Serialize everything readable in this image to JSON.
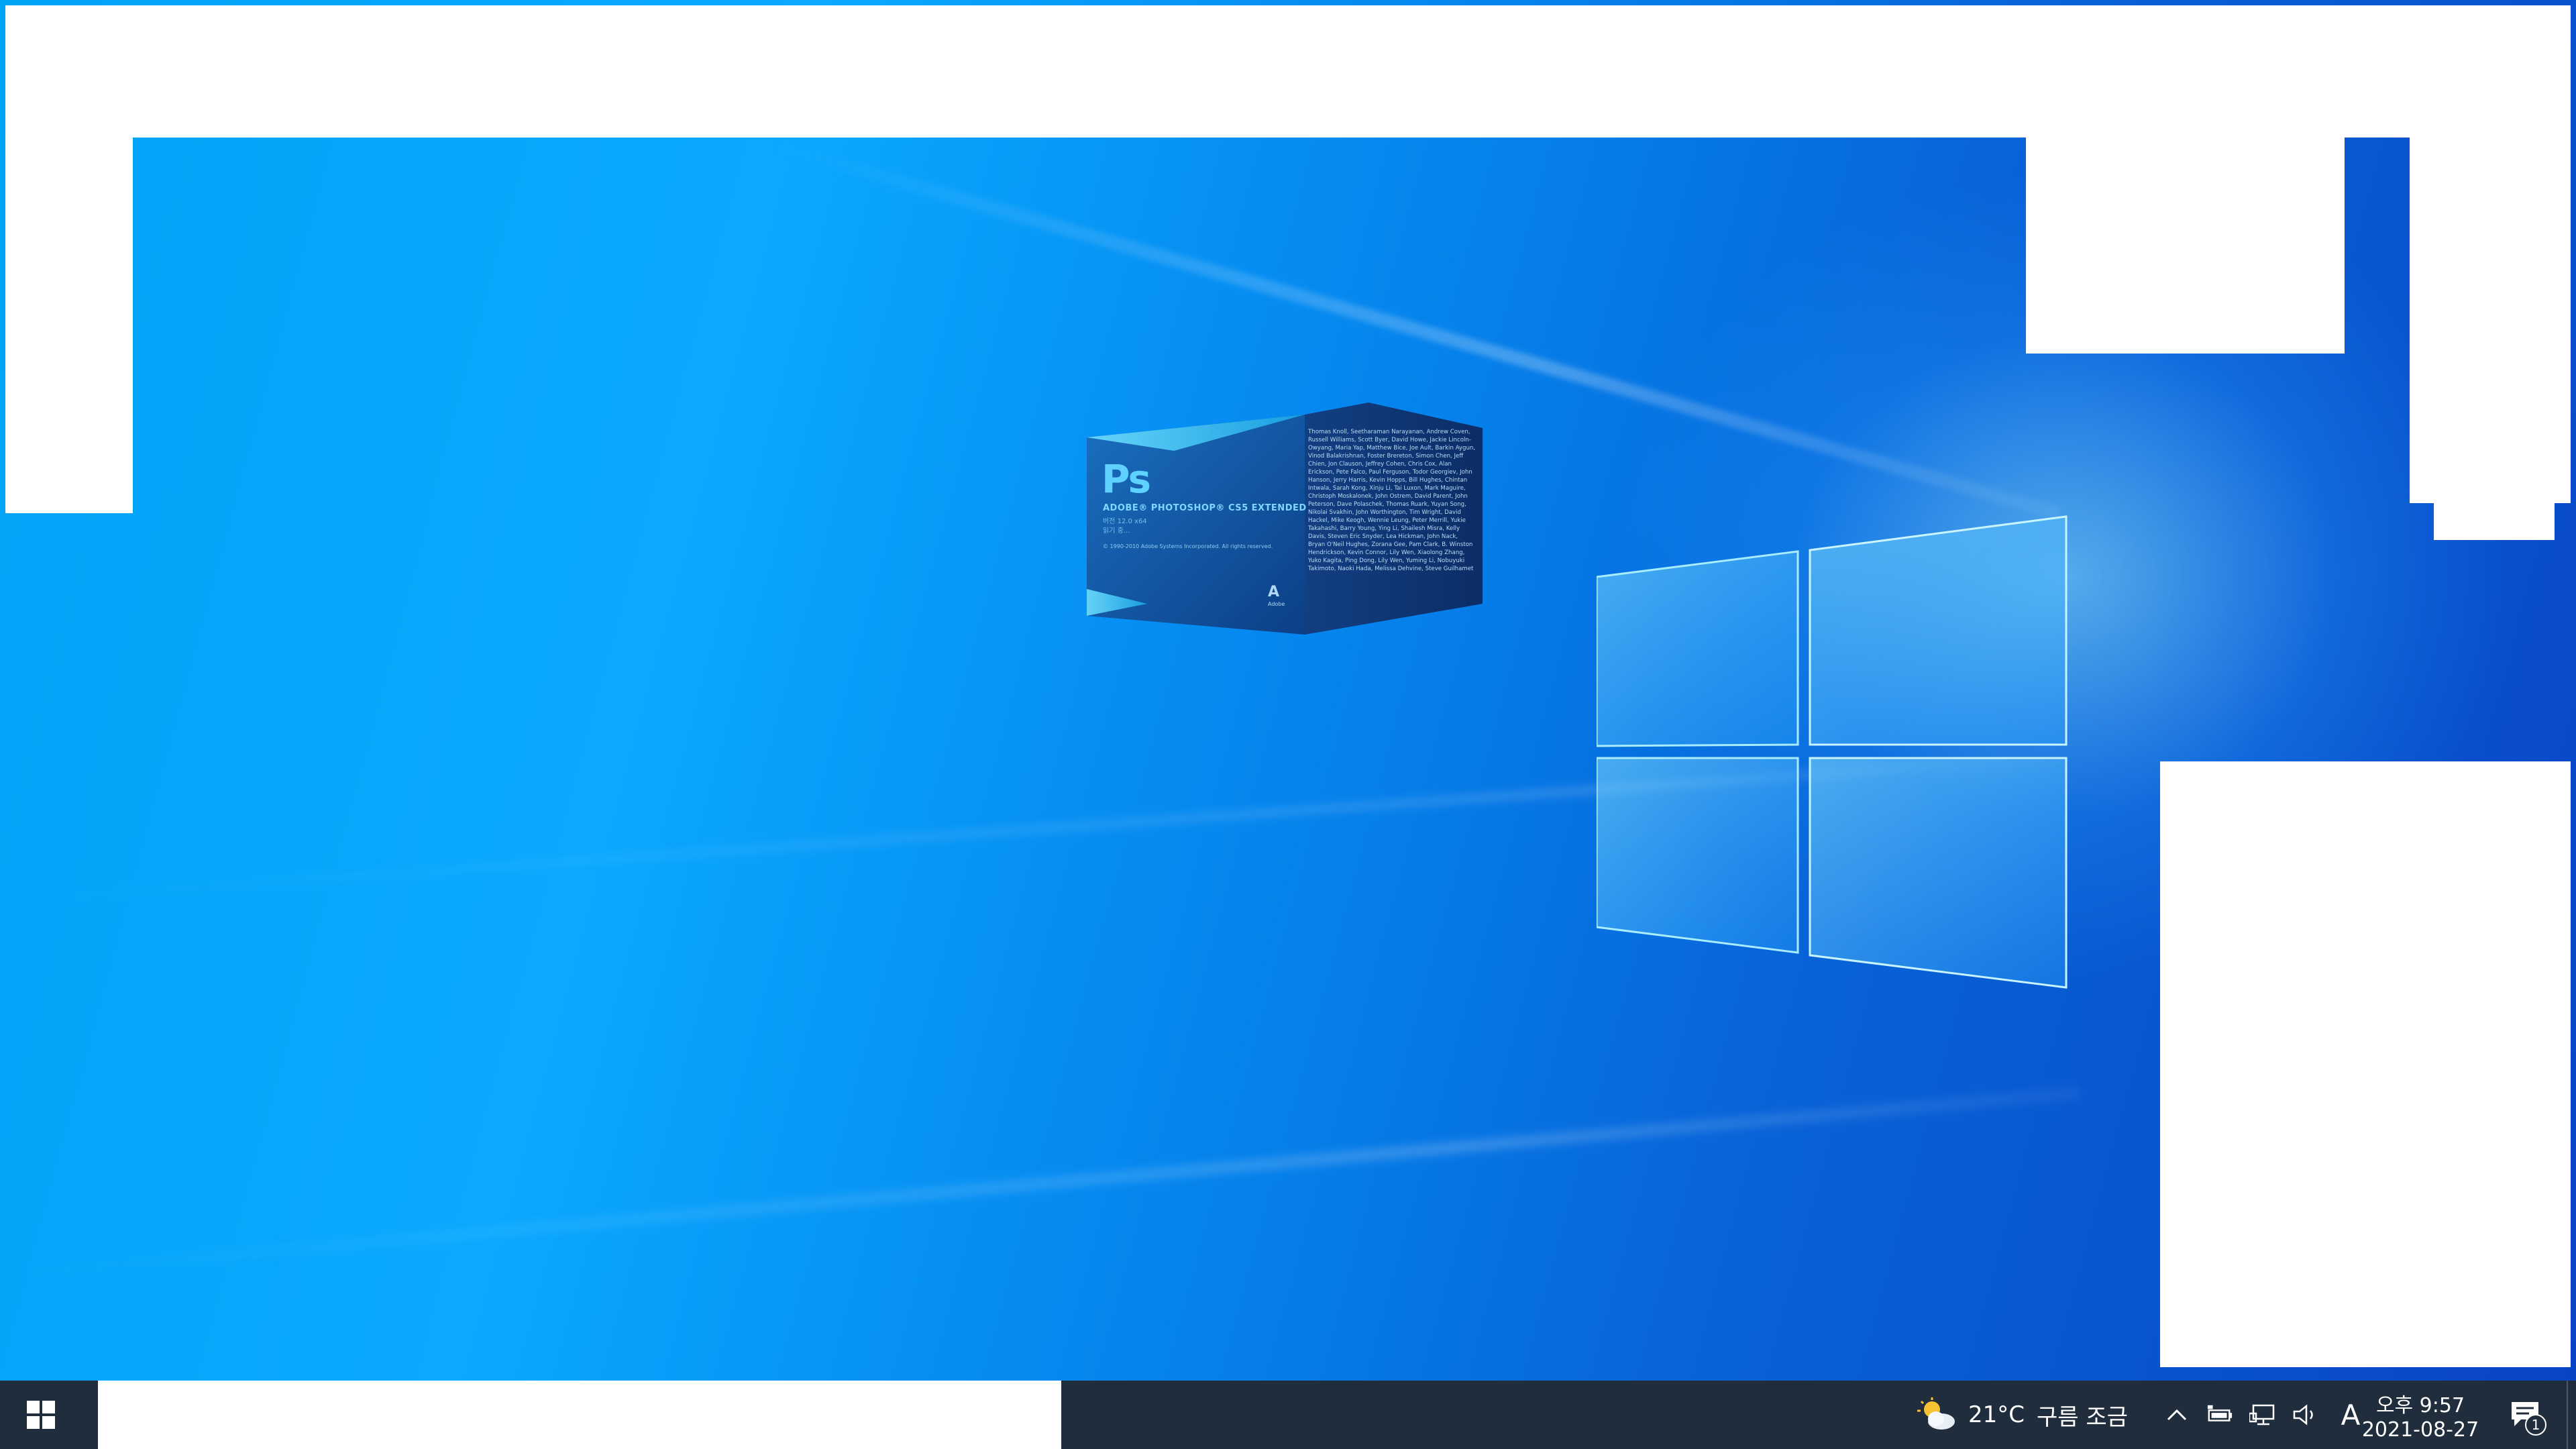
{
  "photoshop_splash": {
    "logo": "Ps",
    "product": "ADOBE® PHOTOSHOP® CS5 EXTENDED",
    "version": "버전 12.0 x64",
    "status": "읽기 중...",
    "copyright": "© 1990-2010 Adobe Systems Incorporated. All rights reserved.",
    "credits": "Thomas Knoll, Seetharaman Narayanan, Andrew Coven, Russell Williams, Scott Byer, David Howe, Jackie Lincoln-Owyang, Maria Yap, Matthew Bice, Joe Ault, Barkin Aygun, Vinod Balakrishnan, Foster Brereton, Simon Chen, Jeff Chien, Jon Clauson, Jeffrey Cohen, Chris Cox, Alan Erickson, Pete Falco, Paul Ferguson, Todor Georgiev, John Hanson, Jerry Harris, Kevin Hopps, Bill Hughes, Chintan Intwala, Sarah Kong, Xinju Li, Tai Luxon, Mark Maguire, Christoph Moskalonek, John Ostrem, David Parent, John Peterson, Dave Polaschek, Thomas Ruark, Yuyan Song, Nikolai Svakhin, John Worthington, Tim Wright, David Hackel, Mike Keogh, Wennie Leung, Peter Merrill, Yukie Takahashi, Barry Young, Ying Li, Shailesh Misra, Kelly Davis, Steven Eric Snyder, Lea Hickman, John Nack, Bryan O'Neil Hughes, Zorana Gee, Pam Clark, B. Winston Hendrickson, Kevin Connor, Lily Wen, Xiaolong Zhang, Yuko Kagita, Ping Dong, Lily Wen, Yuming Li, Nobuyuki Takimoto, Naoki Hada, Melissa Dehvine, Steve Guilhamet",
    "adobe_mark": "A",
    "adobe_word": "Adobe"
  },
  "taskbar": {
    "weather_temp": "21°C",
    "weather_desc": "구름 조금",
    "ime_indicator": "A",
    "clock_time": "오후 9:57",
    "clock_date": "2021-08-27",
    "notification_count": "1"
  },
  "icons": {
    "start": "windows-logo-icon",
    "weather": "partly-cloudy-icon",
    "tray_chevron": "chevron-up-icon",
    "battery": "battery-plug-icon",
    "network": "ethernet-network-icon",
    "volume": "speaker-icon",
    "action_center": "notification-icon"
  },
  "colors": {
    "taskbar_bg": "#1f2d3c",
    "desktop_blue": "#0aa8ff",
    "desktop_deep_blue": "#0a44c6"
  }
}
